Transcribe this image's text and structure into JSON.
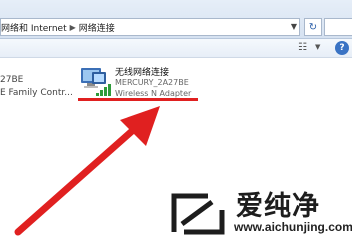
{
  "address_bar": {
    "breadcrumbs": [
      "网络和 Internet",
      "网络连接"
    ],
    "refresh_icon": "refresh-icon"
  },
  "command_bar": {
    "view_icon": "view-options-icon",
    "help_icon": "help-icon",
    "help_label": "?"
  },
  "connections": [
    {
      "name_partial": "27BE",
      "adapter_partial": "E Family Contr..."
    },
    {
      "name": "无线网络连接",
      "ssid": "MERCURY_2A27BE",
      "adapter": "Wireless N Adapter",
      "icon": "wireless-network-icon"
    }
  ],
  "annotation": {
    "arrow_color": "#e02020",
    "underline_color": "#e02020"
  },
  "watermark": {
    "brand_cn": "爱纯净",
    "url": "www.aichunjing.com"
  }
}
